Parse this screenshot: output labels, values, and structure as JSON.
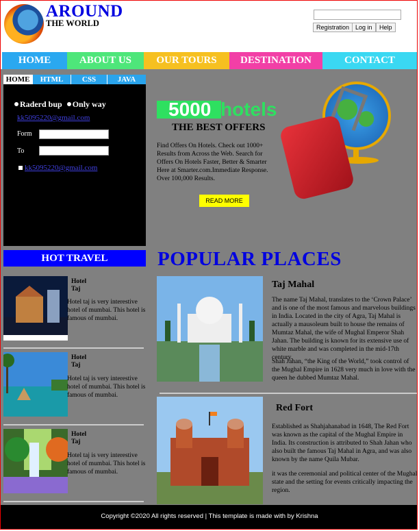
{
  "header": {
    "brand_line1": "AROUND",
    "brand_line2": "THE WORLD",
    "search_placeholder": "",
    "buttons": [
      "Registration",
      "Log in",
      "Help"
    ]
  },
  "nav": [
    {
      "label": "HOME",
      "color": "#2aa8f0"
    },
    {
      "label": "ABOUT US",
      "color": "#4ee67a"
    },
    {
      "label": "OUR TOURS",
      "color": "#f6c020"
    },
    {
      "label": "DESTINATION",
      "color": "#f23fa6"
    },
    {
      "label": "CONTACT",
      "color": "#3ad8f2"
    }
  ],
  "sidebar": {
    "tabs": [
      "HOME",
      "HTML",
      "CSS",
      "JAVA"
    ],
    "radio1": "Raderd bup",
    "radio2": "Only way",
    "email1": "kk5095220@gmail.com",
    "form_label": "Form",
    "to_label": "To",
    "email2": "kk5095220@gmail.com"
  },
  "offer": {
    "count": "5000",
    "word": "hotels",
    "heading": "THE BEST OFFERS",
    "text": "Find Offers On Hotels. Check out 1000+ Results from Across the Web. Search for Offers On Hotels Faster, Better & Smarter Here at Smarter.com.Immediate Response. Over 100,000 Results.",
    "button": "READ MORE"
  },
  "hot_travel": {
    "title": "HOT TRAVEL",
    "items": [
      {
        "name": "Hotel\nTaj",
        "desc": "Hotel taj is very interestive hotel of mumbai. This hotel is famous of mumbai."
      },
      {
        "name": "Hotel\nTaj",
        "desc": "Hotel taj is very interestive hotel of mumbai. This hotel is famous of mumbai."
      },
      {
        "name": "Hotel\nTaj",
        "desc": "Hotel taj is very interestive hotel of mumbai. This hotel is famous of mumbai."
      }
    ]
  },
  "popular": {
    "title": "POPULAR PLACES",
    "places": [
      {
        "name": "Taj Mahal",
        "p1": "The name Taj Mahal, translates to the ‘Crown Palace’ and is one of the most famous and marvelous buildings in India. Located in the city of Agra, Taj Mahal is actually a mausoleum built to house the remains of Mumtaz Mahal, the wife of Mughal Emperor Shah Jahan. The building is known for its extensive use of white marble and was completed in the mid-17th century.",
        "p2": "Shah Jahan, “the King of the World,” took control of the Mughal Empire in 1628 very much in love with the queen he dubbed Mumtaz Mahal."
      },
      {
        "name": "Red Fort",
        "p1": "Established as Shahjahanabad in 1648, The Red Fort was known as the capital of the Mughal Empire in India. Its construction is attributed to Shah Jahan who also built the famous Taj Mahal in Agra, and was also known by the name Quila Mubar.",
        "p2": "it was the ceremonial and political center of the Mughal state and the setting for events critically impacting the region."
      }
    ]
  },
  "footer": {
    "text": "Copyright ©2020 All rights reserved | This template is made with by Krishna"
  }
}
